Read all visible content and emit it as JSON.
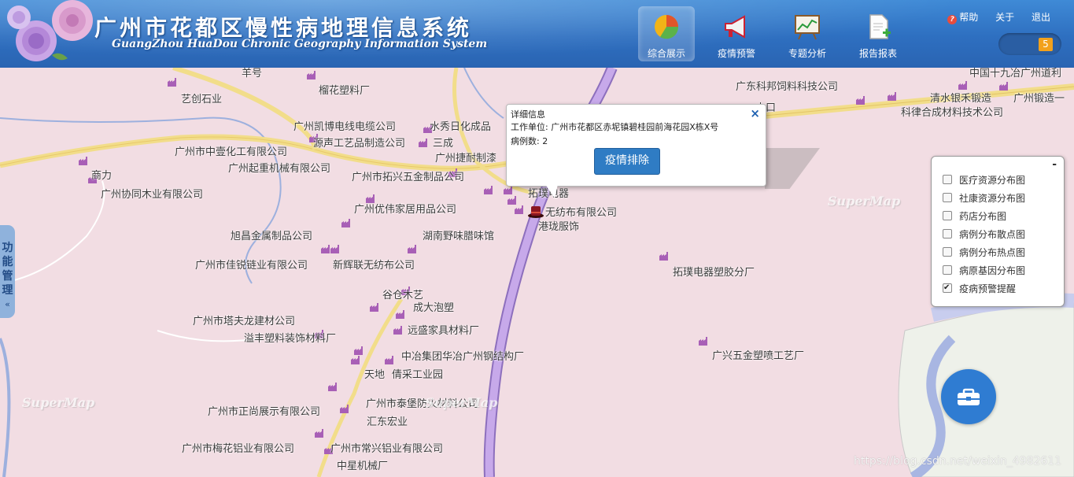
{
  "header": {
    "title_cn": "广州市花都区慢性病地理信息系统",
    "title_en": "GuangZhou HuaDou Chronic Geography Information System",
    "nav": [
      {
        "label": "综合展示",
        "icon": "pie-chart-icon",
        "active": true
      },
      {
        "label": "疫情预警",
        "icon": "megaphone-icon",
        "active": false
      },
      {
        "label": "专题分析",
        "icon": "line-chart-board-icon",
        "active": false
      },
      {
        "label": "报告报表",
        "icon": "report-add-icon",
        "active": false
      }
    ],
    "links": {
      "help": "帮助",
      "about": "关于",
      "logout": "退出"
    },
    "message_count": "5"
  },
  "side_tab": {
    "chars": [
      "功",
      "能",
      "管",
      "理",
      "«"
    ]
  },
  "popup": {
    "title": "详细信息",
    "line1": "工作单位: 广州市花都区赤坭镇碧桂园前海花园X栋X号",
    "line2": "病例数: 2",
    "button": "疫情排除",
    "close": "×"
  },
  "layers": {
    "collapse": "-",
    "items": [
      {
        "label": "医疗资源分布图",
        "checked": false
      },
      {
        "label": "社康资源分布图",
        "checked": false
      },
      {
        "label": "药店分布图",
        "checked": false
      },
      {
        "label": "病例分布散点图",
        "checked": false
      },
      {
        "label": "病例分布热点图",
        "checked": false
      },
      {
        "label": "病原基因分布图",
        "checked": false
      },
      {
        "label": "疫病预警提醒",
        "checked": true
      }
    ]
  },
  "map": {
    "watermark": "SuperMap",
    "pois": [
      "羊号",
      "榴花塑料厂",
      "艺创石业",
      "广东科邦饲料科技公司",
      "中国十九冶广州道利",
      "清水银禾锻造",
      "广州锻造一",
      "科律合成材料技术公司",
      "广州凯博电线电缆公司",
      "水秀日化成品",
      "源声工艺品制造公司",
      "三成",
      "广州市中壹化工有限公司",
      "广州捷耐制漆",
      "广州起重机械有限公司",
      "广州市拓兴五金制品公司",
      "商力",
      "广州协同木业有限公司",
      "拓璞电器",
      "广州优伟家居用品公司",
      "无纺布有限公司",
      "港珑服饰",
      "旭昌金属制品公司",
      "湖南野味腊味馆",
      "广州市佳锐链业有限公司",
      "新辉联无纺布公司",
      "拓璞电器塑胶分厂",
      "谷仓木艺",
      "成大泡塑",
      "广州市塔夫龙建材公司",
      "远盛家具材料厂",
      "溢丰塑料装饰材料厂",
      "中冶集团华冶广州钢结构厂",
      "广兴五金塑喷工艺厂",
      "天地",
      "倩采工业园",
      "广州市泰堡防火材料公司",
      "广州市正尚展示有限公司",
      "汇东宏业",
      "广州市梅花铝业有限公司",
      "广州市常兴铝业有限公司",
      "中星机械厂",
      "山口"
    ]
  },
  "csdn_watermark": "https://blog.csdn.net/weixin_4982611"
}
